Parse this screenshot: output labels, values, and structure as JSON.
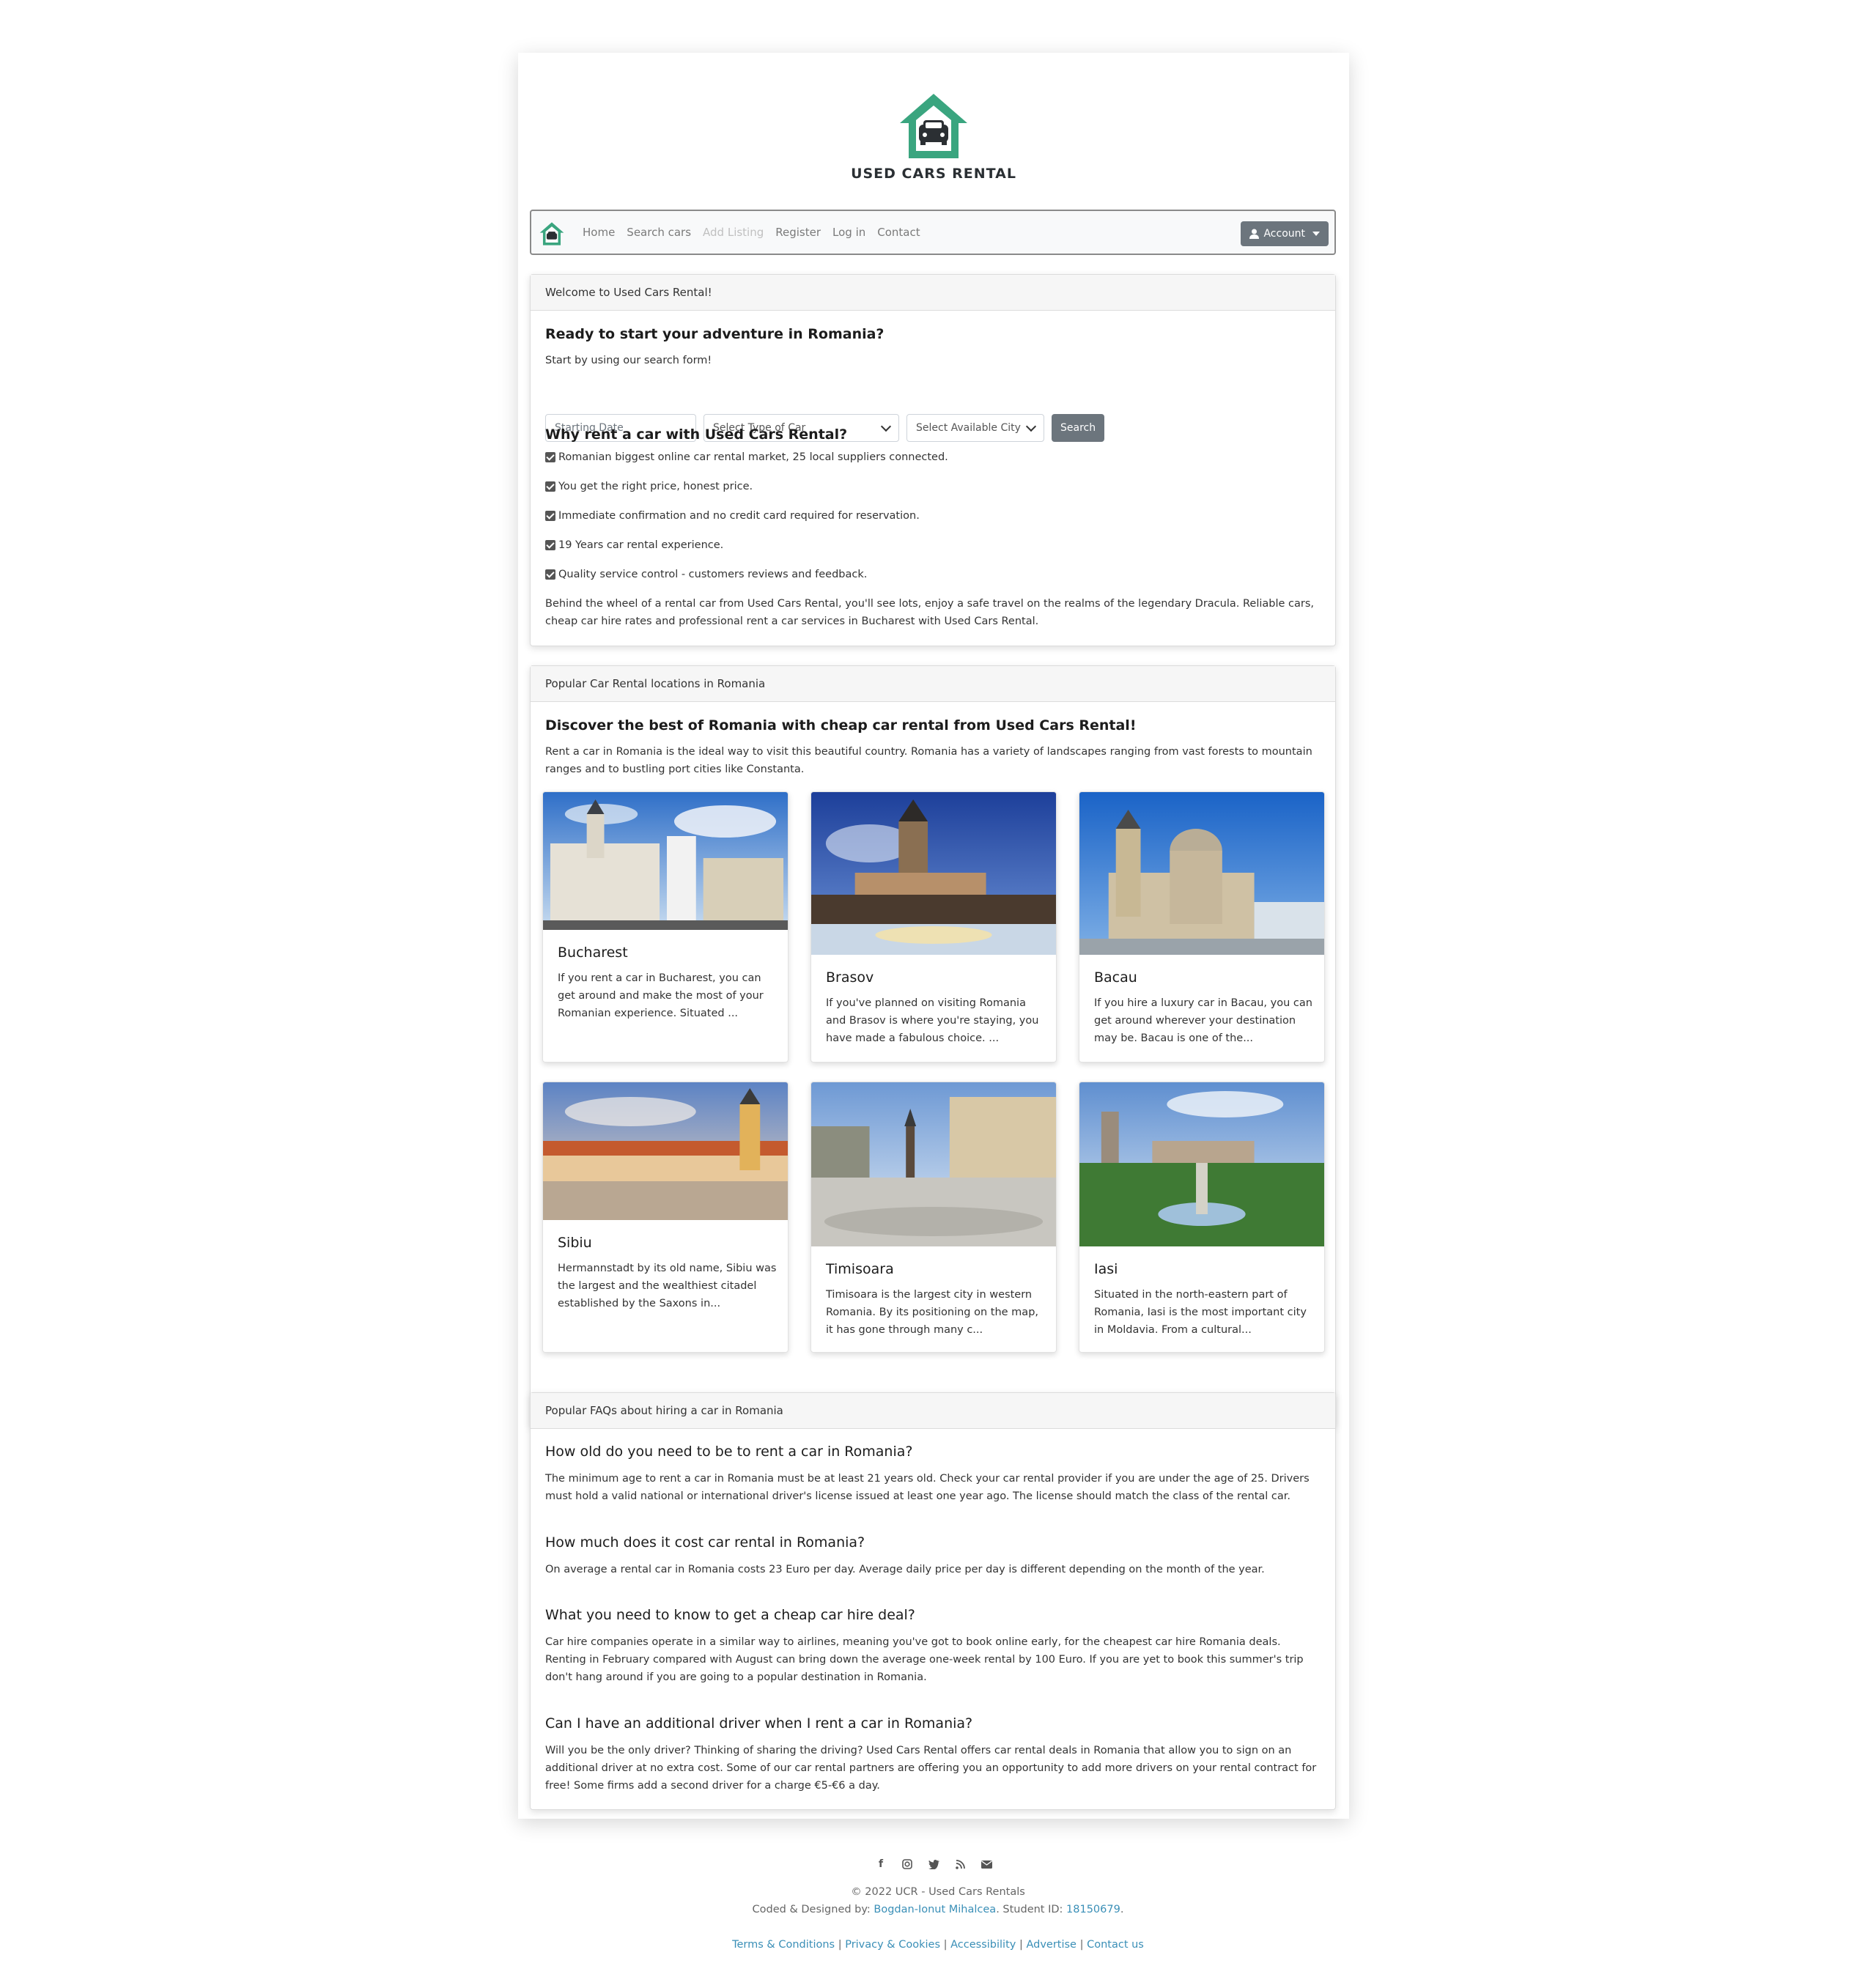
{
  "brand": {
    "logo_text": "USED CARS RENTAL",
    "accent": "#3aa57f"
  },
  "nav": {
    "items": [
      "Home",
      "Search cars",
      "Add Listing",
      "Register",
      "Log in",
      "Contact"
    ],
    "account_label": "Account"
  },
  "welcome": {
    "header": "Welcome to Used Cars Rental!",
    "heading": "Ready to start your adventure in Romania?",
    "sub": "Start by using our search form!",
    "date_placeholder": "Starting Date",
    "car_type_select": "Select Type of Car",
    "city_select": "Select Available City",
    "search_label": "Search",
    "why_heading": "Why rent a car with Used Cars Rental?",
    "reasons": [
      "Romanian biggest online car rental market, 25 local suppliers connected.",
      "You get the right price, honest price.",
      "Immediate confirmation and no credit card required for reservation.",
      "19 Years car rental experience.",
      "Quality service control - customers reviews and feedback."
    ],
    "paragraph": "Behind the wheel of a rental car from Used Cars Rental, you'll see lots, enjoy a safe travel on the realms of the legendary Dracula. Reliable cars, cheap car hire rates and professional rent a car services in Bucharest with Used Cars Rental."
  },
  "locations": {
    "header": "Popular Car Rental locations in Romania",
    "heading": "Discover the best of Romania with cheap car rental from Used Cars Rental!",
    "intro": "Rent a car in Romania is the ideal way to visit this beautiful country. Romania has a variety of landscapes ranging from vast forests to mountain ranges and to bustling port cities like Constanta.",
    "cities": [
      {
        "name": "Bucharest",
        "text": "If you rent a car in Bucharest, you can get around and make the most of your Romanian experience. Situated ..."
      },
      {
        "name": "Brasov",
        "text": "If you've planned on visiting Romania and Brasov is where you're staying, you have made a fabulous choice. ..."
      },
      {
        "name": "Bacau",
        "text": "If you hire a luxury car in Bacau, you can get around wherever your destination may be. Bacau is one of the..."
      },
      {
        "name": "Sibiu",
        "text": "Hermannstadt by its old name, Sibiu was the largest and the wealthiest citadel established by the Saxons in..."
      },
      {
        "name": "Timisoara",
        "text": "Timisoara is the largest city in western Romania. By its positioning on the map, it has gone through many c..."
      },
      {
        "name": "Iasi",
        "text": "Situated in the north-eastern part of Romania, Iasi is the most important city in Moldavia. From a cultural..."
      }
    ]
  },
  "faq": {
    "header": "Popular FAQs about hiring a car in Romania",
    "items": [
      {
        "q": "How old do you need to be to rent a car in Romania?",
        "a": "The minimum age to rent a car in Romania must be at least 21 years old. Check your car rental provider if you are under the age of 25. Drivers must hold a valid national or international driver's license issued at least one year ago. The license should match the class of the rental car."
      },
      {
        "q": "How much does it cost car rental in Romania?",
        "a": "On average a rental car in Romania costs 23 Euro per day. Average daily price per day is different depending on the month of the year."
      },
      {
        "q": "What you need to know to get a cheap car hire deal?",
        "a": "Car hire companies operate in a similar way to airlines, meaning you've got to book online early, for the cheapest car hire Romania deals. Renting in February compared with August can bring down the average one-week rental by 100 Euro. If you are yet to book this summer's trip don't hang around if you are going to a popular destination in Romania."
      },
      {
        "q": "Can I have an additional driver when I rent a car in Romania?",
        "a": "Will you be the only driver? Thinking of sharing the driving? Used Cars Rental offers car rental deals in Romania that allow you to sign on an additional driver at no extra cost. Some of our car rental partners are offering you an opportunity to add more drivers on your rental contract for free! Some firms add a second driver for a charge €5-€6 a day."
      }
    ]
  },
  "footer": {
    "social_icons": [
      "facebook-icon",
      "instagram-icon",
      "twitter-icon",
      "rss-icon",
      "envelope-icon"
    ],
    "copyright": "© 2022 UCR - Used Cars Rentals",
    "coded_prefix": "Coded & Designed by:",
    "author": "Bogdan-Ionut Mihalcea",
    "student_prefix": ". Student ID:",
    "student_id": "18150679",
    "links": [
      "Terms & Conditions",
      "Privacy & Cookies",
      "Accessibility",
      "Advertise",
      "Contact us"
    ]
  }
}
